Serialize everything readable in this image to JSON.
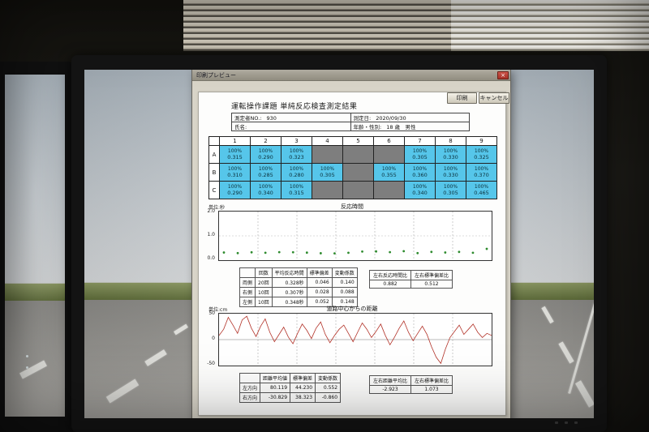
{
  "colors": {
    "cell_active": "#56c6ea",
    "cell_empty": "#7e7e7e",
    "reaction_dot_green": "#2e8b2e",
    "distance_line_red": "#b23228",
    "close_button_red": "#b5443c"
  },
  "window": {
    "title": "印刷プレビュー",
    "close_glyph": "×",
    "print_button": "印刷",
    "cancel_button": "キャンセル"
  },
  "report": {
    "title": "運転操作課題 単純反応検査測定結果",
    "info": {
      "no_label": "測定者NO.:",
      "no_value": "930",
      "date_label": "測定日:",
      "date_value": "2020/09/30",
      "name_label": "氏名:",
      "name_value": "",
      "age_label": "年齢・性別:",
      "age_value": "18 歳　男性"
    },
    "grid": {
      "col_headers": [
        "1",
        "2",
        "3",
        "4",
        "5",
        "6",
        "7",
        "8",
        "9"
      ],
      "rows": [
        {
          "label": "A",
          "cells": [
            [
              "100%",
              "0.315"
            ],
            [
              "100%",
              "0.290"
            ],
            [
              "100%",
              "0.323"
            ],
            null,
            null,
            null,
            [
              "100%",
              "0.305"
            ],
            [
              "100%",
              "0.330"
            ],
            [
              "100%",
              "0.325"
            ]
          ]
        },
        {
          "label": "B",
          "cells": [
            [
              "100%",
              "0.310"
            ],
            [
              "100%",
              "0.285"
            ],
            [
              "100%",
              "0.280"
            ],
            [
              "100%",
              "0.305"
            ],
            null,
            [
              "100%",
              "0.355"
            ],
            [
              "100%",
              "0.360"
            ],
            [
              "100%",
              "0.330"
            ],
            [
              "100%",
              "0.370"
            ]
          ]
        },
        {
          "label": "C",
          "cells": [
            [
              "100%",
              "0.290"
            ],
            [
              "100%",
              "0.340"
            ],
            [
              "100%",
              "0.315"
            ],
            null,
            null,
            null,
            [
              "100%",
              "0.340"
            ],
            [
              "100%",
              "0.305"
            ],
            [
              "100%",
              "0.465"
            ]
          ]
        }
      ]
    },
    "reaction_section": {
      "unit": "単位:秒",
      "chart_title": "反応時間",
      "y_labels": [
        "2.0",
        "1.0",
        "0.0"
      ],
      "stats": {
        "headers": [
          "",
          "回数",
          "平均反応時間",
          "標準偏差",
          "変動係数"
        ],
        "rows": [
          [
            "両側",
            "20回",
            "0.328秒",
            "0.046",
            "0.140"
          ],
          [
            "右側",
            "10回",
            "0.307秒",
            "0.028",
            "0.088"
          ],
          [
            "左側",
            "10回",
            "0.348秒",
            "0.052",
            "0.148"
          ]
        ]
      },
      "ratios": {
        "headers": [
          "左右反応時間比",
          "左右標準偏差比"
        ],
        "values": [
          "0.882",
          "0.512"
        ]
      }
    },
    "distance_section": {
      "unit": "単位:cm",
      "chart_title": "道路中心からの距離",
      "y_labels": [
        "50",
        "0",
        "-50"
      ],
      "stats": {
        "headers": [
          "",
          "距離平均値",
          "標準偏差",
          "変動係数"
        ],
        "rows": [
          [
            "左方向",
            "80.119",
            "44.230",
            "0.552"
          ],
          [
            "右方向",
            "-30.829",
            "38.323",
            "-0.860"
          ]
        ]
      },
      "ratios": {
        "headers": [
          "左右距離平均比",
          "左右標準偏差比"
        ],
        "values": [
          "-2.923",
          "1.073"
        ]
      }
    }
  },
  "chart_data": [
    {
      "type": "scatter",
      "title": "反応時間",
      "ylabel": "秒",
      "ylim": [
        0,
        2.0
      ],
      "x": [
        1,
        2,
        3,
        4,
        5,
        6,
        7,
        8,
        9,
        10,
        11,
        12,
        13,
        14,
        15,
        16,
        17,
        18,
        19,
        20
      ],
      "y": [
        0.315,
        0.29,
        0.323,
        0.305,
        0.33,
        0.325,
        0.31,
        0.285,
        0.28,
        0.305,
        0.355,
        0.36,
        0.33,
        0.37,
        0.29,
        0.34,
        0.315,
        0.34,
        0.305,
        0.465
      ]
    },
    {
      "type": "line",
      "title": "道路中心からの距離",
      "ylabel": "cm",
      "ylim": [
        -50,
        50
      ],
      "y": [
        8,
        20,
        43,
        28,
        12,
        38,
        45,
        22,
        6,
        26,
        40,
        14,
        -4,
        10,
        24,
        5,
        -8,
        12,
        30,
        18,
        2,
        22,
        34,
        10,
        -6,
        8,
        20,
        28,
        12,
        -4,
        14,
        32,
        20,
        4,
        16,
        30,
        8,
        -10,
        5,
        22,
        36,
        14,
        -2,
        12,
        26,
        10,
        -14,
        -34,
        -46,
        -18,
        4,
        16,
        28,
        10,
        20,
        30,
        14,
        4,
        12,
        8
      ]
    }
  ]
}
